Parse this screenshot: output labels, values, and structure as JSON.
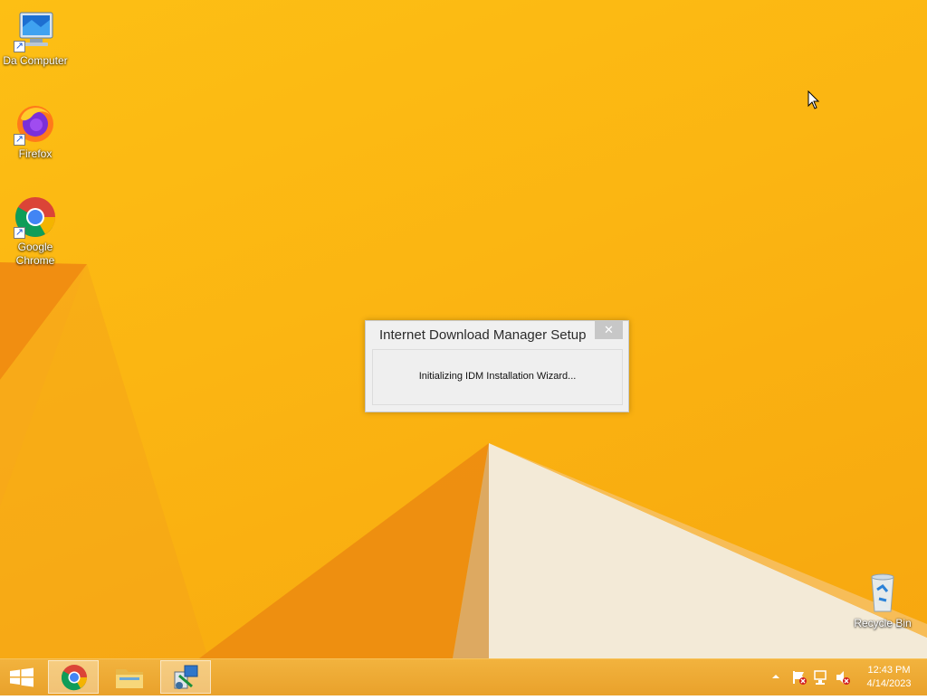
{
  "desktop": {
    "icons": [
      {
        "label": "Da Computer",
        "icon": "computer-icon"
      },
      {
        "label": "Firefox",
        "icon": "firefox-icon"
      },
      {
        "label": "Google Chrome",
        "icon": "chrome-icon"
      },
      {
        "label": "Recycle Bin",
        "icon": "recycle-bin-icon"
      }
    ]
  },
  "dialog": {
    "title": "Internet Download Manager Setup",
    "close_glyph": "✕",
    "message": "Initializing IDM Installation Wizard..."
  },
  "taskbar": {
    "buttons": [
      {
        "name": "start-button",
        "icon": "windows-logo-icon"
      },
      {
        "name": "chrome",
        "icon": "chrome-icon",
        "active": true
      },
      {
        "name": "file-explorer",
        "icon": "folder-icon",
        "active": false
      },
      {
        "name": "idm-setup",
        "icon": "installer-icon",
        "active": true
      }
    ],
    "tray": {
      "icons": [
        "show-hidden-icons-chevron",
        "action-center-flag-icon",
        "network-icon",
        "volume-muted-icon"
      ],
      "time": "12:43 PM",
      "date": "4/14/2023"
    }
  },
  "colors": {
    "wallpaper": "#fbb512",
    "taskbar": "#eba52f",
    "dialog_bg": "#f0f0f0",
    "close_button": "#c7c7c7"
  }
}
